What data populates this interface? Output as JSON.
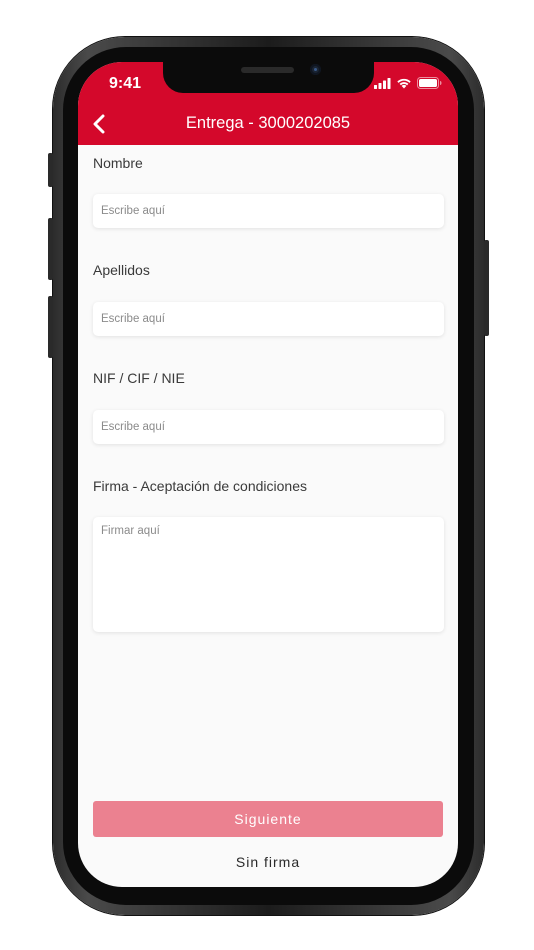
{
  "status_bar": {
    "time": "9:41",
    "icons": [
      "signal-icon",
      "wifi-icon",
      "battery-icon"
    ]
  },
  "header": {
    "title": "Entrega - 3000202085",
    "back_icon": "chevron-left-icon"
  },
  "form": {
    "fields": [
      {
        "label": "Nombre",
        "placeholder": "Escribe aquí"
      },
      {
        "label": "Apellidos",
        "placeholder": "Escribe aquí"
      },
      {
        "label": "NIF / CIF / NIE",
        "placeholder": "Escribe aquí"
      }
    ],
    "signature": {
      "label": "Firma - Aceptación de condiciones",
      "placeholder": "Firmar aquí"
    }
  },
  "actions": {
    "next_label": "Siguiente",
    "no_signature_label": "Sin firma"
  },
  "colors": {
    "brand_red": "#d4082b",
    "button_disabled": "#eb8190"
  }
}
